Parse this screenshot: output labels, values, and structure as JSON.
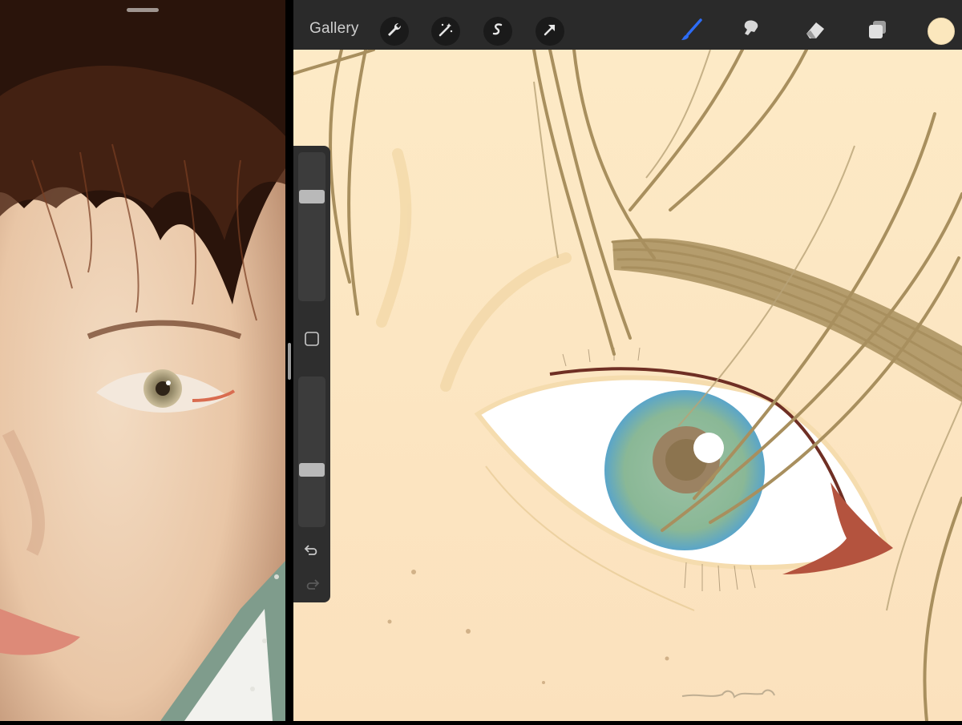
{
  "toolbar": {
    "gallery_label": "Gallery",
    "tools": [
      "wrench-icon",
      "magic-wand-icon",
      "selection-icon",
      "move-arrow-icon"
    ],
    "right_tools": [
      "brush-icon",
      "smudge-icon",
      "eraser-icon",
      "layers-icon"
    ],
    "active_tool": "brush",
    "active_color": "#fbe7bd",
    "accent_color": "#2d6cf5"
  },
  "sidebar": {
    "brush_size_level": 0.72,
    "opacity_level": 0.37,
    "buttons": [
      "modify-square-icon",
      "undo-icon",
      "redo-icon"
    ]
  },
  "canvas": {
    "background_color": "#fbe9c6",
    "hair_color": "#a88f5e",
    "iris_color": "#8db898",
    "liner_color": "#b4533e"
  }
}
